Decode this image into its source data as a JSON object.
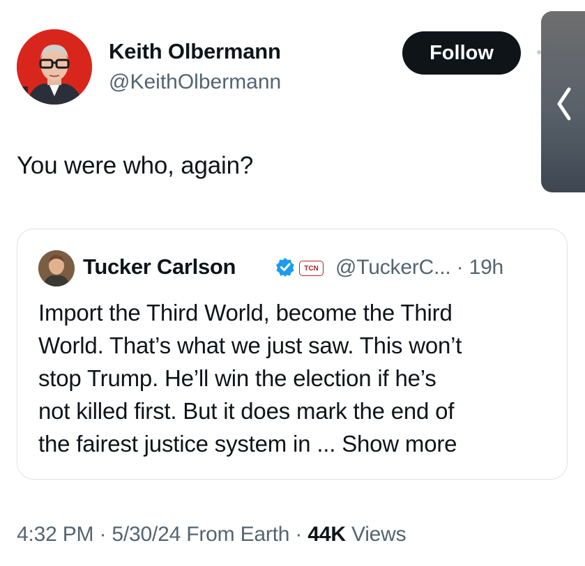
{
  "author": {
    "name": "Keith Olbermann",
    "handle": "@KeithOlbermann",
    "avatar_bg": "#d9261c"
  },
  "follow_button": {
    "label": "Follow"
  },
  "tweet": {
    "text": "You were who, again?"
  },
  "quoted": {
    "name": "Tucker Carlson",
    "badge": "TCN",
    "handle": "@TuckerC...",
    "separator": "·",
    "time": "19h",
    "body_lines": [
      "Import the Third World, become the Third",
      "World. That’s what we just saw. This won’t",
      "stop Trump. He’ll win the election if he’s",
      "not killed first. But it does mark the end of",
      "the fairest justice system in ..."
    ],
    "show_more": "Show more",
    "verified_color": "#1d9bf0"
  },
  "footer": {
    "time": "4:32 PM",
    "date": "5/30/24",
    "source": "From Earth",
    "views_count": "44K",
    "views_label": "Views",
    "separator": "·"
  },
  "icons": {
    "side_handle": "chevron-left-icon",
    "verified": "verified-badge-icon"
  }
}
